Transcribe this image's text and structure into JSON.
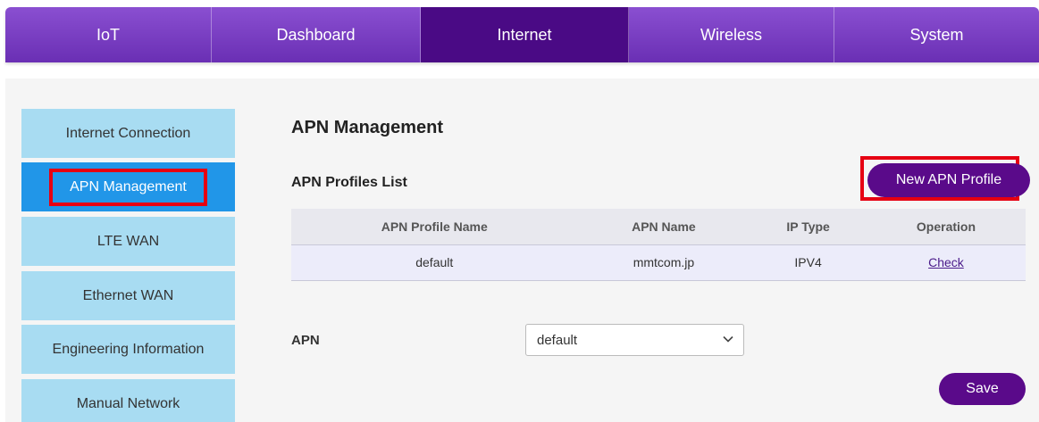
{
  "topnav": {
    "items": [
      {
        "label": "IoT"
      },
      {
        "label": "Dashboard"
      },
      {
        "label": "Internet"
      },
      {
        "label": "Wireless"
      },
      {
        "label": "System"
      }
    ],
    "active": "Internet",
    "color": "#6a2fb4",
    "active_color": "#4a0a85"
  },
  "sidebar": {
    "items": [
      {
        "label": "Internet Connection"
      },
      {
        "label": "APN Management"
      },
      {
        "label": "LTE WAN"
      },
      {
        "label": "Ethernet WAN"
      },
      {
        "label": "Engineering Information"
      },
      {
        "label": "Manual Network"
      }
    ],
    "active": "APN Management"
  },
  "main": {
    "title": "APN Management",
    "profiles_title": "APN Profiles List",
    "new_button": "New APN Profile",
    "table": {
      "headers": [
        "APN Profile Name",
        "APN Name",
        "IP Type",
        "Operation"
      ],
      "rows": [
        [
          "default",
          "mmtcom.jp",
          "IPV4",
          "Check"
        ]
      ]
    },
    "apn_label": "APN",
    "apn_select_value": "default",
    "save_button": "Save"
  },
  "highlight_color": "#e60012"
}
